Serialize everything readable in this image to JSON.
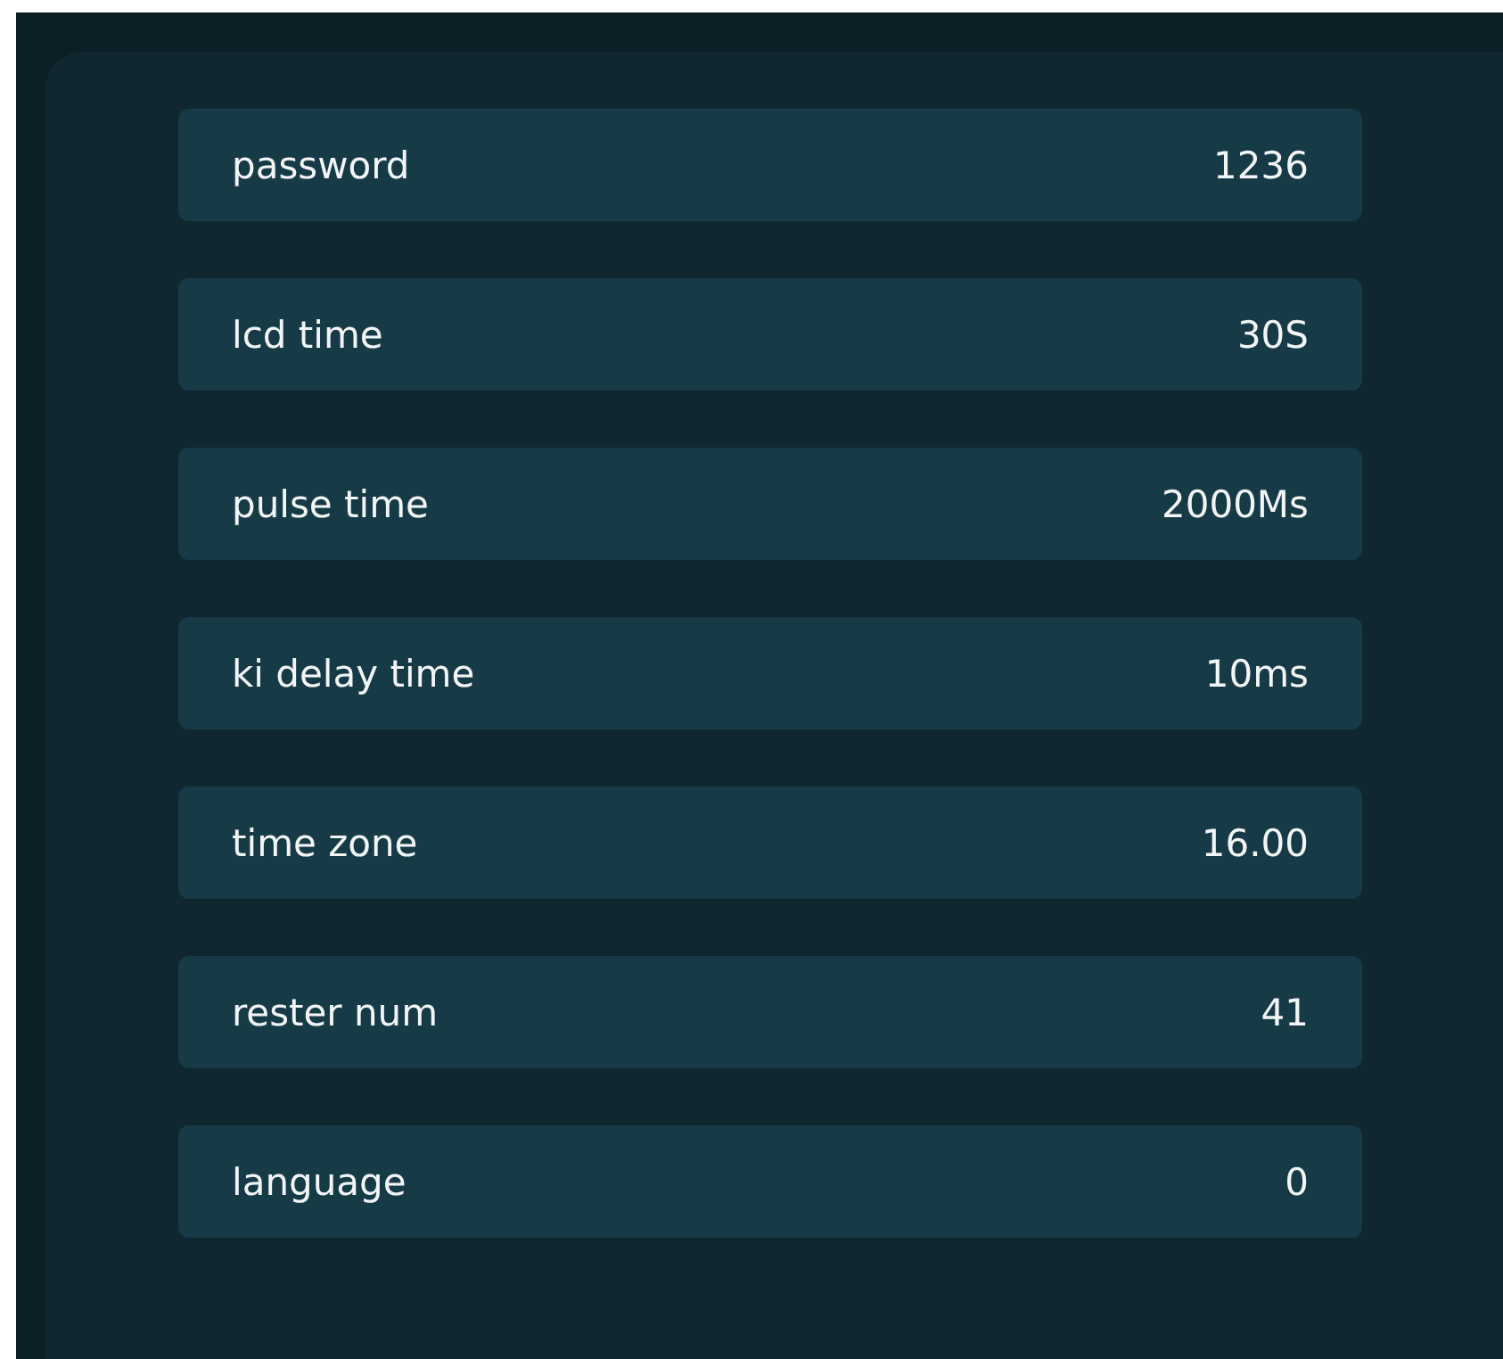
{
  "settings": [
    {
      "label": "password",
      "value": "1236"
    },
    {
      "label": "lcd time",
      "value": "30S"
    },
    {
      "label": "pulse time",
      "value": "2000Ms"
    },
    {
      "label": "ki delay time",
      "value": "10ms"
    },
    {
      "label": "time zone",
      "value": "16.00"
    },
    {
      "label": "rester num",
      "value": "41"
    },
    {
      "label": "language",
      "value": "0"
    }
  ]
}
